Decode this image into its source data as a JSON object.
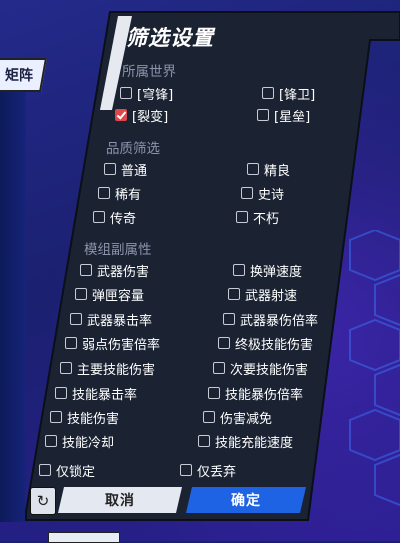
{
  "left_tab": {
    "label": "矩阵"
  },
  "dialog": {
    "title": "筛选设置",
    "sections": {
      "world": {
        "label": "所属世界",
        "options": [
          {
            "label": "[穹锋]",
            "checked": false
          },
          {
            "label": "[锋卫]",
            "checked": false
          },
          {
            "label": "[裂变]",
            "checked": true
          },
          {
            "label": "[星垒]",
            "checked": false
          }
        ]
      },
      "quality": {
        "label": "品质筛选",
        "options": [
          {
            "label": "普通",
            "checked": false
          },
          {
            "label": "精良",
            "checked": false
          },
          {
            "label": "稀有",
            "checked": false
          },
          {
            "label": "史诗",
            "checked": false
          },
          {
            "label": "传奇",
            "checked": false
          },
          {
            "label": "不朽",
            "checked": false
          }
        ]
      },
      "attributes": {
        "label": "模组副属性",
        "options": [
          {
            "label": "武器伤害",
            "checked": false
          },
          {
            "label": "换弹速度",
            "checked": false
          },
          {
            "label": "弹匣容量",
            "checked": false
          },
          {
            "label": "武器射速",
            "checked": false
          },
          {
            "label": "武器暴击率",
            "checked": false
          },
          {
            "label": "武器暴伤倍率",
            "checked": false
          },
          {
            "label": "弱点伤害倍率",
            "checked": false
          },
          {
            "label": "终极技能伤害",
            "checked": false
          },
          {
            "label": "主要技能伤害",
            "checked": false
          },
          {
            "label": "次要技能伤害",
            "checked": false
          },
          {
            "label": "技能暴击率",
            "checked": false
          },
          {
            "label": "技能暴伤倍率",
            "checked": false
          },
          {
            "label": "技能伤害",
            "checked": false
          },
          {
            "label": "伤害减免",
            "checked": false
          },
          {
            "label": "技能冷却",
            "checked": false
          },
          {
            "label": "技能充能速度",
            "checked": false
          }
        ]
      },
      "flags": {
        "options": [
          {
            "label": "仅锁定",
            "checked": false
          },
          {
            "label": "仅丢弃",
            "checked": false
          }
        ]
      }
    },
    "buttons": {
      "reset_icon": "refresh-icon",
      "cancel": "取消",
      "confirm": "确定"
    }
  },
  "colors": {
    "panel": "#1b2333",
    "accent_red": "#e0474c",
    "confirm_blue": "#1e63e4",
    "background": "#1a1f6e"
  }
}
